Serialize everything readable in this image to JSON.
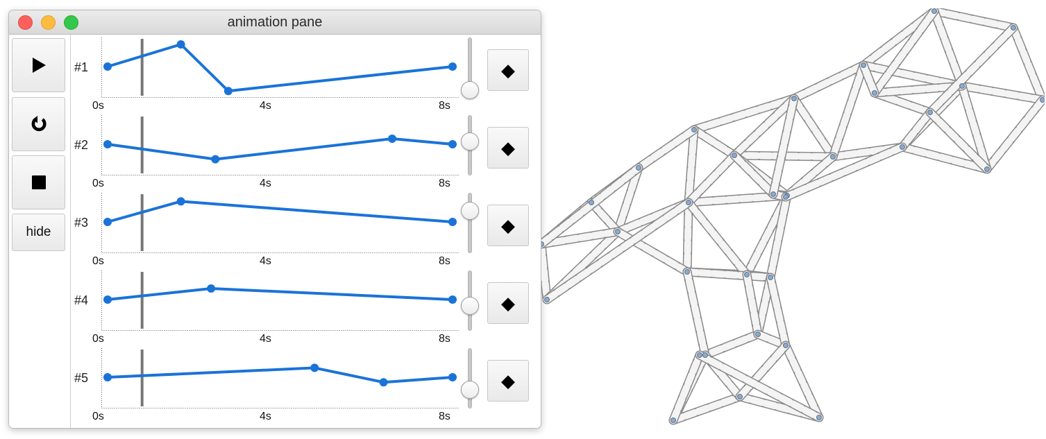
{
  "window": {
    "title": "animation pane",
    "controls": {
      "play_icon": "play-icon",
      "loop_icon": "loop-icon",
      "stop_icon": "stop-icon",
      "hide_label": "hide"
    },
    "accent_color": "#1a73d8",
    "tracks": [
      {
        "label": "#1",
        "keyframes": [
          [
            0,
            0.5
          ],
          [
            1.7,
            0.9
          ],
          [
            2.8,
            0.06
          ],
          [
            8,
            0.5
          ]
        ],
        "slider_value": 0.0,
        "keyframe_icon": "◆"
      },
      {
        "label": "#2",
        "keyframes": [
          [
            0,
            0.5
          ],
          [
            2.5,
            0.23
          ],
          [
            6.6,
            0.6
          ],
          [
            8,
            0.5
          ]
        ],
        "slider_value": 0.6,
        "keyframe_icon": "◆"
      },
      {
        "label": "#3",
        "keyframes": [
          [
            0,
            0.5
          ],
          [
            1.7,
            0.87
          ],
          [
            8,
            0.5
          ]
        ],
        "slider_value": 0.8,
        "keyframe_icon": "◆"
      },
      {
        "label": "#4",
        "keyframes": [
          [
            0,
            0.5
          ],
          [
            2.4,
            0.7
          ],
          [
            8,
            0.5
          ]
        ],
        "slider_value": 0.4,
        "keyframe_icon": "◆"
      },
      {
        "label": "#5",
        "keyframes": [
          [
            0,
            0.5
          ],
          [
            4.8,
            0.67
          ],
          [
            6.4,
            0.41
          ],
          [
            8,
            0.5
          ]
        ],
        "slider_value": 0.25,
        "keyframe_icon": "◆"
      }
    ],
    "time_ticks": [
      "0s",
      "4s",
      "8s"
    ],
    "time_range": [
      0,
      8
    ],
    "playhead_time": 0.8
  }
}
